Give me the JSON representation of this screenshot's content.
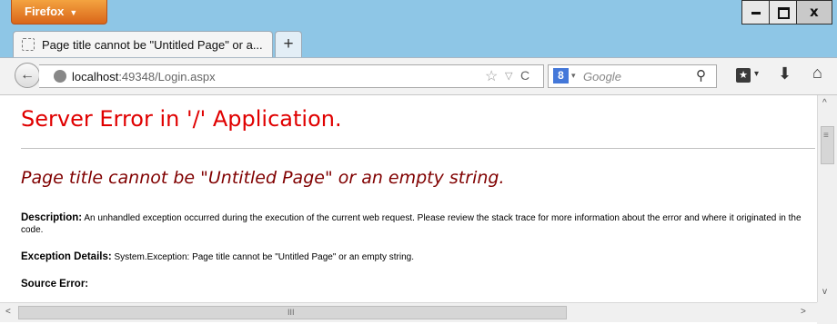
{
  "titlebar": {
    "app_button": "Firefox",
    "app_button_arrow": "▼",
    "minimize_glyph": "",
    "maximize_glyph": "",
    "close_glyph": "x"
  },
  "tabs": [
    {
      "label": "Page title cannot be \"Untitled Page\" or a..."
    }
  ],
  "new_tab": "+",
  "navbar": {
    "back_glyph": "←",
    "url_host": "localhost",
    "url_rest": ":49348/Login.aspx",
    "star_glyph": "☆",
    "dropdown_glyph": "▽",
    "reload_glyph": "C",
    "search_engine_glyph": "8",
    "search_dropdown_glyph": "▾",
    "search_placeholder": "Google",
    "search_icon_glyph": "⚲",
    "bookmarks_glyph": "★",
    "bookmarks_dd_glyph": "▾",
    "download_glyph": "⬇",
    "home_glyph": "⌂"
  },
  "page": {
    "heading": "Server Error in '/' Application.",
    "subheading": "Page title cannot be \"Untitled Page\" or an empty string.",
    "description_label": "Description:",
    "description_text": " An unhandled exception occurred during the execution of the current web request. Please review the stack trace for more information about the error and where it originated in the code.",
    "exception_label": "Exception Details:",
    "exception_text": " System.Exception: Page title cannot be \"Untitled Page\" or an empty string.",
    "source_label": "Source Error:"
  },
  "scrollbars": {
    "up": "^",
    "down": "v",
    "left": "<",
    "right": ">",
    "vgrip": "≡",
    "hgrip": "III"
  },
  "colors": {
    "heading": "#e00000",
    "subheading": "#800000",
    "firefox_button": "#e8842c"
  }
}
